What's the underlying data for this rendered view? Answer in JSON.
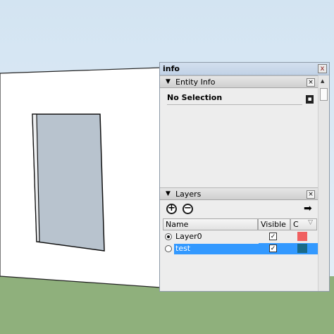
{
  "tray": {
    "title": "info",
    "close_glyph": "x"
  },
  "entity_info": {
    "header": "Entity Info",
    "selection": "No Selection"
  },
  "layers": {
    "header": "Layers",
    "add_glyph": "+",
    "remove_glyph": "−",
    "columns": {
      "name": "Name",
      "visible": "Visible",
      "color": "C"
    },
    "rows": [
      {
        "name": "Layer0",
        "active": true,
        "visible": true,
        "selected": false,
        "color": "#f06060"
      },
      {
        "name": "test",
        "active": false,
        "visible": true,
        "selected": true,
        "color": "#1a6a88"
      }
    ]
  },
  "icons": {
    "collapse": "triangle-down-icon",
    "close": "close-icon",
    "details": "details-icon",
    "add": "plus-circle-icon",
    "remove": "minus-circle-icon",
    "layer_options": "arrow-right-icon",
    "check": "checkmark-icon",
    "sort": "sort-icon"
  },
  "colors": {
    "sky": "#dce9f4",
    "ground": "#8fb07c",
    "wall": "#ffffff",
    "glass": "#b9c4cf",
    "selection_blue": "#3399ff"
  }
}
